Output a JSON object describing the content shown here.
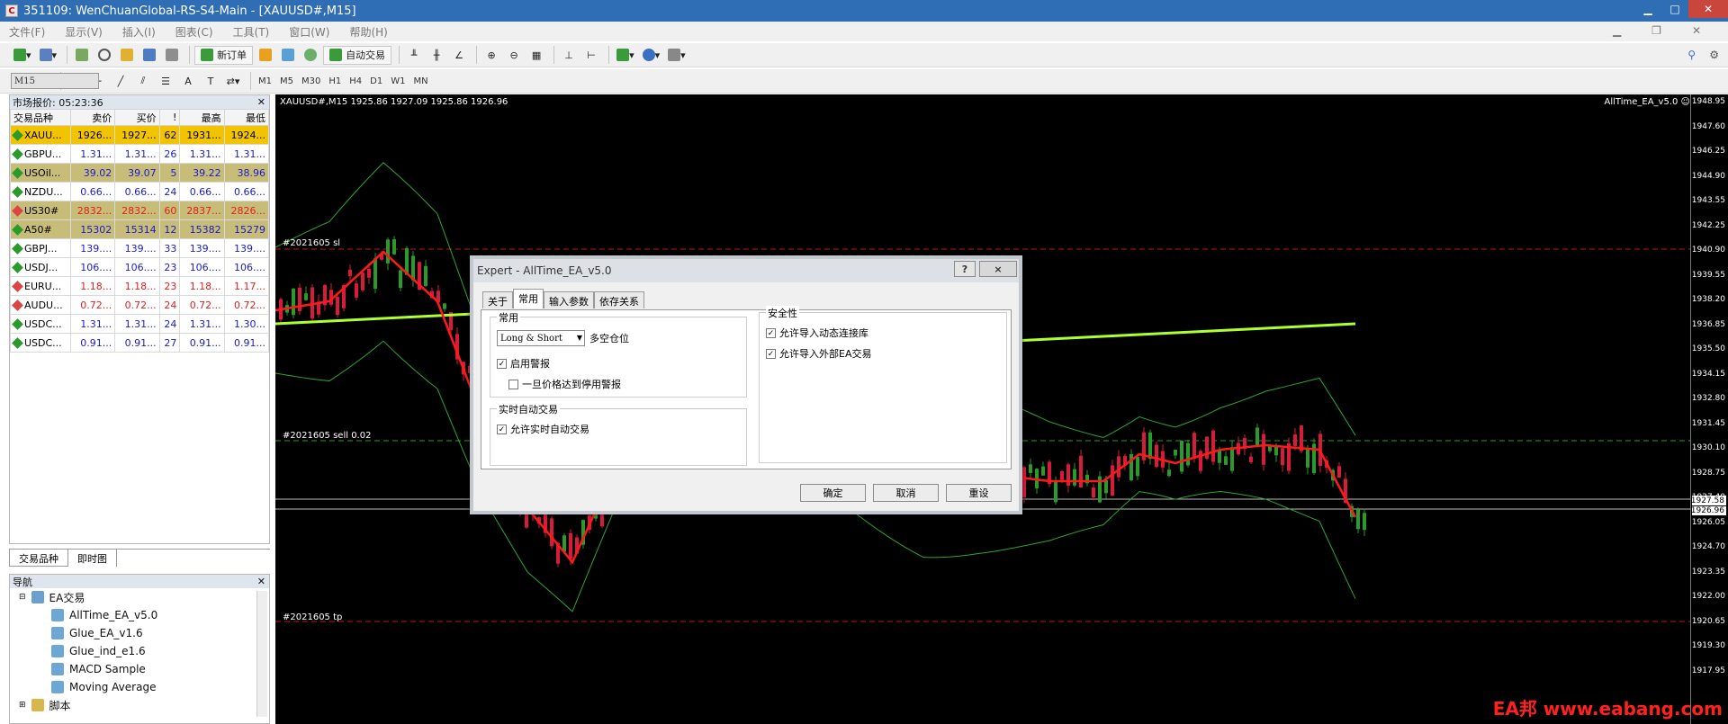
{
  "window": {
    "title": "351109: WenChuanGlobal-RS-S4-Main - [XAUUSD#,M15]",
    "icon": "app-logo-icon"
  },
  "menu": [
    "文件(F)",
    "显示(V)",
    "插入(I)",
    "图表(C)",
    "工具(T)",
    "窗口(W)",
    "帮助(H)"
  ],
  "toolbar": {
    "new_order": "新订单",
    "auto_trading": "自动交易"
  },
  "timeframes": [
    "M1",
    "M5",
    "M15",
    "M30",
    "H1",
    "H4",
    "D1",
    "W1",
    "MN"
  ],
  "selected_timeframe": "M15",
  "market_watch": {
    "title": "市场报价: 05:23:36",
    "columns": [
      "交易品种",
      "卖价",
      "买价",
      "!",
      "最高",
      "最低"
    ],
    "rows": [
      {
        "s": "XAUU...",
        "bid": "1926...",
        "ask": "1927...",
        "sp": "62",
        "hi": "1931...",
        "lo": "1924...",
        "style": "gold"
      },
      {
        "s": "GBPU...",
        "bid": "1.31...",
        "ask": "1.31...",
        "sp": "26",
        "hi": "1.31...",
        "lo": "1.31...",
        "style": "blue"
      },
      {
        "s": "USOil...",
        "bid": "39.02",
        "ask": "39.07",
        "sp": "5",
        "hi": "39.22",
        "lo": "38.96",
        "style": "olive"
      },
      {
        "s": "NZDU...",
        "bid": "0.66...",
        "ask": "0.66...",
        "sp": "24",
        "hi": "0.66...",
        "lo": "0.66...",
        "style": "blue"
      },
      {
        "s": "US30#",
        "bid": "2832...",
        "ask": "2832...",
        "sp": "60",
        "hi": "2837...",
        "lo": "2826...",
        "style": "olive-red"
      },
      {
        "s": "A50#",
        "bid": "15302",
        "ask": "15314",
        "sp": "12",
        "hi": "15382",
        "lo": "15279",
        "style": "olive"
      },
      {
        "s": "GBPJ...",
        "bid": "139....",
        "ask": "139....",
        "sp": "33",
        "hi": "139....",
        "lo": "139....",
        "style": "blue"
      },
      {
        "s": "USDJ...",
        "bid": "106....",
        "ask": "106....",
        "sp": "23",
        "hi": "106....",
        "lo": "106....",
        "style": "blue"
      },
      {
        "s": "EURU...",
        "bid": "1.18...",
        "ask": "1.18...",
        "sp": "23",
        "hi": "1.18...",
        "lo": "1.17...",
        "style": "red"
      },
      {
        "s": "AUDU...",
        "bid": "0.72...",
        "ask": "0.72...",
        "sp": "24",
        "hi": "0.72...",
        "lo": "0.72...",
        "style": "red"
      },
      {
        "s": "USDC...",
        "bid": "1.31...",
        "ask": "1.31...",
        "sp": "24",
        "hi": "1.31...",
        "lo": "1.30...",
        "style": "blue"
      },
      {
        "s": "USDC...",
        "bid": "0.91...",
        "ask": "0.91...",
        "sp": "27",
        "hi": "0.91...",
        "lo": "0.91...",
        "style": "blue"
      }
    ],
    "tabs": [
      "交易品种",
      "即时图"
    ]
  },
  "navigator": {
    "title": "导航",
    "folder": "EA交易",
    "items": [
      "AllTime_EA_v5.0",
      "Glue_EA_v1.6",
      "Glue_ind_e1.6",
      "MACD Sample",
      "Moving Average"
    ],
    "scripts": "脚本"
  },
  "chart": {
    "info": "XAUUSD#,M15  1925.86 1927.09 1925.86 1926.96",
    "ea_label": "AllTime_EA_v5.0 ☺",
    "line_labels": {
      "sl": "#2021605 sl",
      "sell": "#2021605 sell 0.02",
      "tp": "#2021605 tp"
    },
    "price_ticks": [
      "1948.95",
      "1947.60",
      "1946.25",
      "1944.90",
      "1943.55",
      "1942.25",
      "1940.90",
      "1939.55",
      "1938.20",
      "1936.85",
      "1935.50",
      "1934.15",
      "1932.80",
      "1931.45",
      "1930.10",
      "1928.75",
      "1927.40",
      "1926.05",
      "1924.70",
      "1923.35",
      "1922.00",
      "1920.65",
      "1919.30",
      "1917.95"
    ],
    "price_badges": {
      "ask": "1927.58",
      "bid": "1926.96"
    }
  },
  "dialog": {
    "title": "Expert - AllTime_EA_v5.0",
    "help": "?",
    "close": "×",
    "tabs": [
      "关于",
      "常用",
      "输入参数",
      "依存关系"
    ],
    "group_common": "常用",
    "position_select": "Long & Short",
    "position_label": "多空仓位",
    "enable_alerts": "启用警报",
    "disable_alert_once": "一旦价格达到停用警报",
    "group_live": "实时自动交易",
    "allow_live": "允许实时自动交易",
    "group_safety": "安全性",
    "allow_dll": "允许导入动态连接库",
    "allow_external": "允许导入外部EA交易",
    "ok": "确定",
    "cancel": "取消",
    "reset": "重设"
  },
  "watermark": "EA邦 www.eabang.com"
}
